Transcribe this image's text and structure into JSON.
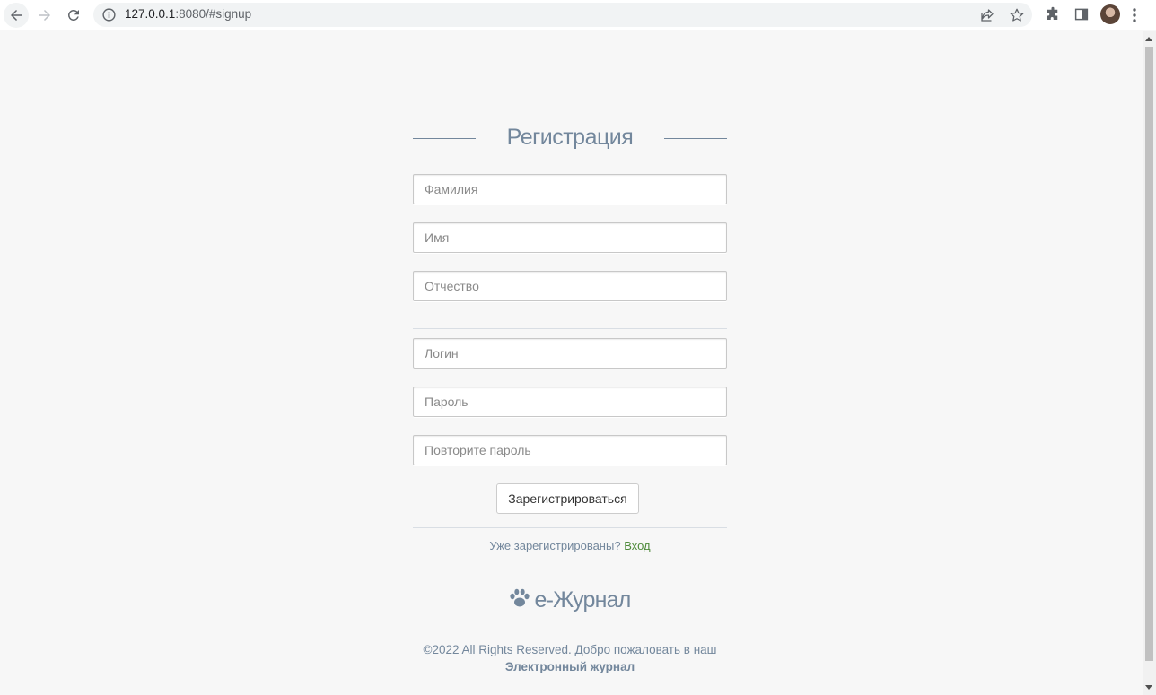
{
  "browser": {
    "url_host": "127.0.0.1",
    "url_path": ":8080/#signup"
  },
  "form": {
    "title": "Регистрация",
    "fields": {
      "last_name": "Фамилия",
      "first_name": "Имя",
      "patronymic": "Отчество",
      "login": "Логин",
      "password": "Пароль",
      "password_repeat": "Повторите пароль"
    },
    "submit_label": "Зарегистрироваться",
    "already_text": "Уже зарегистрированы?",
    "login_link": "Вход"
  },
  "brand": {
    "name": "e-Журнал",
    "icon": "paw-icon"
  },
  "footer": {
    "text": "©2022 All Rights Reserved. Добро пожаловать в наш",
    "bold_text": "Электронный журнал"
  },
  "colors": {
    "accent": "#73879c",
    "link": "#4e8a3a",
    "background": "#f7f7f7"
  }
}
